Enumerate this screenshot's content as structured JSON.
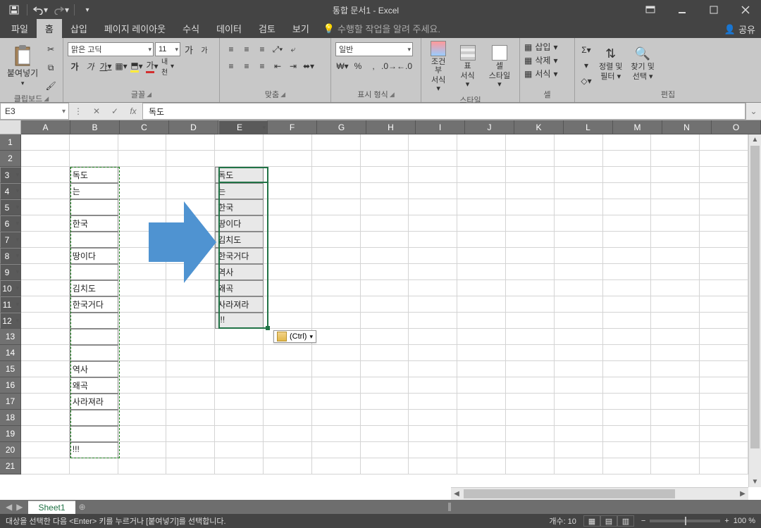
{
  "title": "통합 문서1 - Excel",
  "tabs": {
    "file": "파일",
    "home": "홈",
    "insert": "삽입",
    "layout": "페이지 레이아웃",
    "formulas": "수식",
    "data": "데이터",
    "review": "검토",
    "view": "보기",
    "tell_me": "수행할 작업을 알려 주세요.",
    "share": "공유"
  },
  "ribbon": {
    "clipboard": {
      "paste": "붙여넣기",
      "label": "클립보드"
    },
    "font": {
      "name": "맑은 고딕",
      "size": "11",
      "bold": "가",
      "italic": "가",
      "underline": "가",
      "label": "글꼴",
      "hanja": "내천"
    },
    "align": {
      "label": "맞춤"
    },
    "number": {
      "format": "일반",
      "label": "표시 형식"
    },
    "styles": {
      "cond": "조건부",
      "cond2": "서식",
      "table": "표",
      "table2": "서식",
      "cell": "셀",
      "cell2": "스타일",
      "label": "스타일"
    },
    "cells": {
      "insert": "삽입",
      "delete": "삭제",
      "format": "서식",
      "label": "셀"
    },
    "editing": {
      "sort": "정렬 및",
      "sort2": "필터",
      "find": "찾기 및",
      "find2": "선택",
      "label": "편집"
    }
  },
  "namebox": "E3",
  "formula": "독도",
  "columns": [
    "A",
    "B",
    "C",
    "D",
    "E",
    "F",
    "G",
    "H",
    "I",
    "J",
    "K",
    "L",
    "M",
    "N",
    "O"
  ],
  "rows": [
    "1",
    "2",
    "3",
    "4",
    "5",
    "6",
    "7",
    "8",
    "9",
    "10",
    "11",
    "12",
    "13",
    "14",
    "15",
    "16",
    "17",
    "18",
    "19",
    "20",
    "21"
  ],
  "b_col": {
    "3": "독도",
    "4": "는",
    "5": "",
    "6": "한국",
    "7": "",
    "8": "땅이다",
    "9": "",
    "10": "김치도",
    "11": "한국거다",
    "12": "",
    "13": "",
    "14": "",
    "15": "역사",
    "16": "왜곡",
    "17": "사라져라",
    "18": "",
    "19": "",
    "20": "!!!"
  },
  "e_col": {
    "3": "독도",
    "4": "는",
    "5": "한국",
    "6": "땅이다",
    "7": "김치도",
    "8": "한국거다",
    "9": "역사",
    "10": "왜곡",
    "11": "사라져라",
    "12": "!!!"
  },
  "paste_tag": "(Ctrl)",
  "sheet": {
    "name": "Sheet1"
  },
  "status": {
    "left": "대상을 선택한 다음 <Enter> 키를 누르거나 [붙여넣기]를 선택합니다.",
    "count": "개수: 10",
    "zoom": "100 %"
  }
}
